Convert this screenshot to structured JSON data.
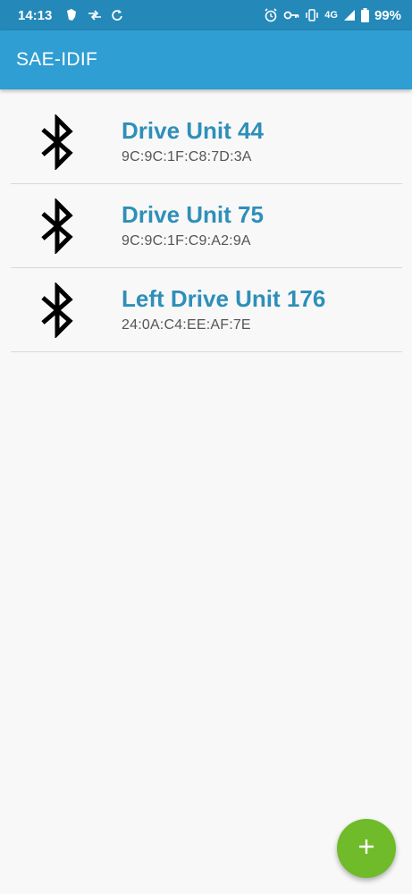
{
  "status_bar": {
    "time": "14:13",
    "network": "4G",
    "battery": "99%",
    "icons": [
      "notification-icon",
      "data-transfer-icon",
      "sync-icon",
      "alarm-icon",
      "vpn-key-icon",
      "vibrate-icon",
      "signal-icon",
      "battery-icon"
    ]
  },
  "app_bar": {
    "title": "SAE-IDIF",
    "color": "#2f9ed2"
  },
  "devices": [
    {
      "name": "Drive Unit 44",
      "address": "9C:9C:1F:C8:7D:3A",
      "icon": "bluetooth-icon"
    },
    {
      "name": "Drive Unit 75",
      "address": "9C:9C:1F:C9:A2:9A",
      "icon": "bluetooth-icon"
    },
    {
      "name": "Left Drive Unit 176",
      "address": "24:0A:C4:EE:AF:7E",
      "icon": "bluetooth-icon"
    }
  ],
  "fab": {
    "icon": "plus-icon",
    "color": "#6fbb2a"
  }
}
